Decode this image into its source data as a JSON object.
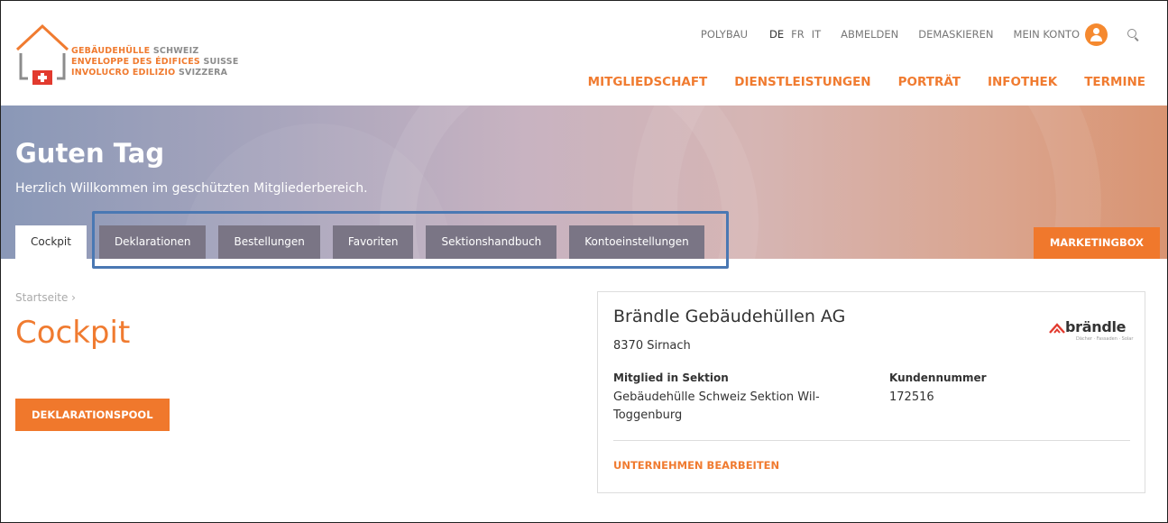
{
  "logo": {
    "lines": [
      {
        "primary": "GEBÄUDEHÜLLE",
        "secondary": "SCHWEIZ"
      },
      {
        "primary": "ENVELOPPE DES ÉDIFICES",
        "secondary": "SUISSE"
      },
      {
        "primary": "INVOLUCRO EDILIZIO",
        "secondary": "SVIZZERA"
      }
    ]
  },
  "meta_nav": {
    "polybau": "POLYBAU",
    "languages": [
      "DE",
      "FR",
      "IT"
    ],
    "logout": "ABMELDEN",
    "unmask": "DEMASKIEREN",
    "account": "MEIN KONTO"
  },
  "main_nav": [
    "MITGLIEDSCHAFT",
    "DIENSTLEISTUNGEN",
    "PORTRÄT",
    "INFOTHEK",
    "TERMINE"
  ],
  "hero": {
    "title": "Guten Tag",
    "subtitle": "Herzlich Willkommen im geschützten Mitgliederbereich."
  },
  "tabs": [
    "Cockpit",
    "Deklarationen",
    "Bestellungen",
    "Favoriten",
    "Sektionshandbuch",
    "Kontoeinstellungen"
  ],
  "marketing_button": "MARKETINGBOX",
  "breadcrumb": "Startseite ›",
  "page_title": "Cockpit",
  "pool_button": "DEKLARATIONSPOOL",
  "company_card": {
    "name": "Brändle Gebäudehüllen AG",
    "city": "8370 Sirnach",
    "brand_name": "brändle",
    "brand_tagline": "Dächer · Fassaden · Solar",
    "section_label": "Mitglied in Sektion",
    "section_value": "Gebäudehülle Schweiz Sektion Wil-Toggenburg",
    "customer_label": "Kundennummer",
    "customer_value": "172516",
    "edit_link": "UNTERNEHMEN BEARBEITEN"
  },
  "colors": {
    "accent": "#f07b30",
    "tab_bg": "#7a7585",
    "highlight": "#4a78b3"
  }
}
